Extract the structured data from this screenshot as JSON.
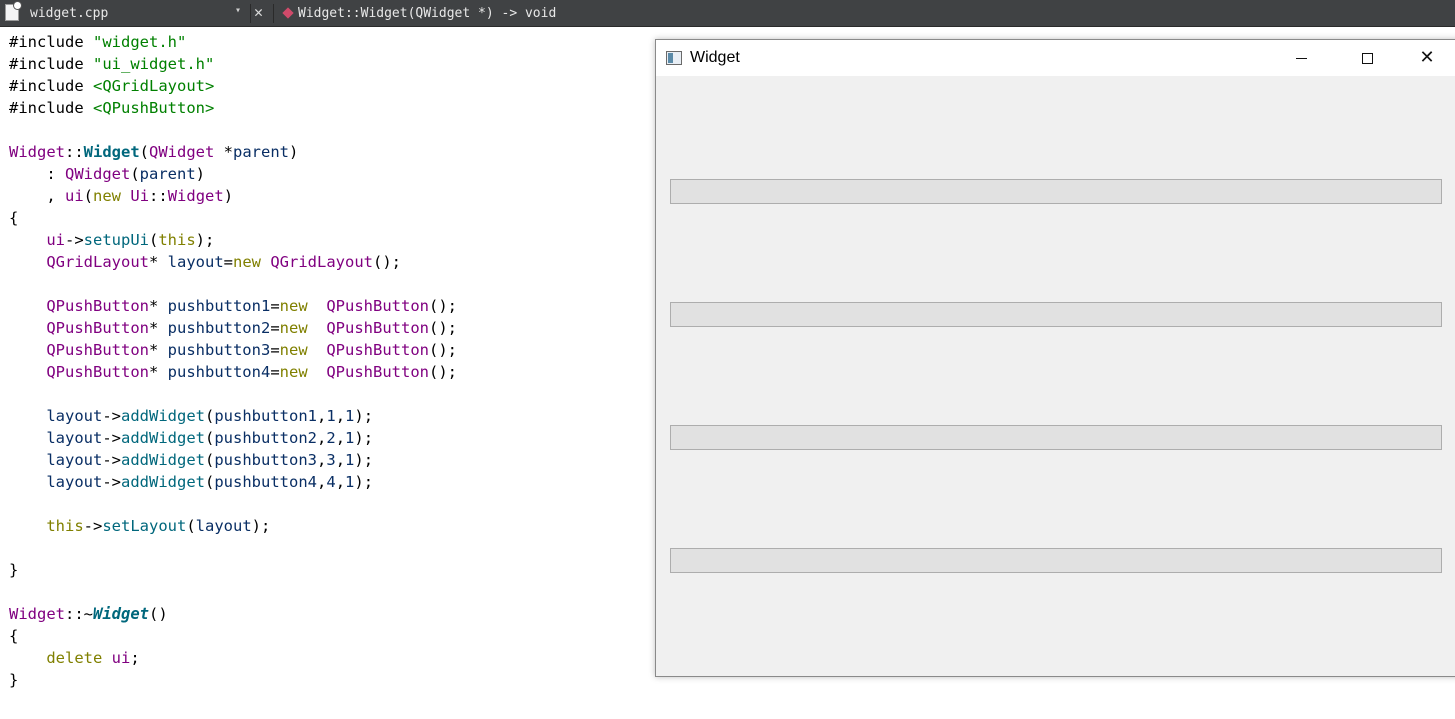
{
  "toolbar": {
    "file_name": "widget.cpp",
    "dropdown_glyph": "▾",
    "close_glyph": "✕",
    "symbol": "Widget::Widget(QWidget *) -> void"
  },
  "window": {
    "title": "Widget",
    "close_glyph": "✕",
    "buttons": [
      {
        "label": ""
      },
      {
        "label": ""
      },
      {
        "label": ""
      },
      {
        "label": ""
      }
    ]
  },
  "code": {
    "lines": [
      [
        {
          "t": "#include ",
          "c": ""
        },
        {
          "t": "\"widget.h\"",
          "c": "str"
        }
      ],
      [
        {
          "t": "#include ",
          "c": ""
        },
        {
          "t": "\"ui_widget.h\"",
          "c": "str"
        }
      ],
      [
        {
          "t": "#include ",
          "c": ""
        },
        {
          "t": "<QGridLayout>",
          "c": "str"
        }
      ],
      [
        {
          "t": "#include ",
          "c": ""
        },
        {
          "t": "<QPushButton>",
          "c": "str"
        }
      ],
      [],
      [
        {
          "t": "Widget",
          "c": "ty"
        },
        {
          "t": "::",
          "c": ""
        },
        {
          "t": "Widget",
          "c": "fnb"
        },
        {
          "t": "(",
          "c": ""
        },
        {
          "t": "QWidget",
          "c": "ty"
        },
        {
          "t": " *",
          "c": ""
        },
        {
          "t": "parent",
          "c": "var"
        },
        {
          "t": ")",
          "c": ""
        }
      ],
      [
        {
          "t": "    : ",
          "c": ""
        },
        {
          "t": "QWidget",
          "c": "ty"
        },
        {
          "t": "(",
          "c": ""
        },
        {
          "t": "parent",
          "c": "var"
        },
        {
          "t": ")",
          "c": ""
        }
      ],
      [
        {
          "t": "    , ",
          "c": ""
        },
        {
          "t": "ui",
          "c": "ty"
        },
        {
          "t": "(",
          "c": ""
        },
        {
          "t": "new",
          "c": "kw"
        },
        {
          "t": " ",
          "c": ""
        },
        {
          "t": "Ui",
          "c": "ty"
        },
        {
          "t": "::",
          "c": ""
        },
        {
          "t": "Widget",
          "c": "ty"
        },
        {
          "t": ")",
          "c": ""
        }
      ],
      [
        {
          "t": "{",
          "c": ""
        }
      ],
      [
        {
          "t": "    ",
          "c": ""
        },
        {
          "t": "ui",
          "c": "ty"
        },
        {
          "t": "->",
          "c": ""
        },
        {
          "t": "setupUi",
          "c": "fn"
        },
        {
          "t": "(",
          "c": ""
        },
        {
          "t": "this",
          "c": "kw"
        },
        {
          "t": ");",
          "c": ""
        }
      ],
      [
        {
          "t": "    ",
          "c": ""
        },
        {
          "t": "QGridLayout",
          "c": "ty"
        },
        {
          "t": "* ",
          "c": ""
        },
        {
          "t": "layout",
          "c": "var"
        },
        {
          "t": "=",
          "c": ""
        },
        {
          "t": "new",
          "c": "kw"
        },
        {
          "t": " ",
          "c": ""
        },
        {
          "t": "QGridLayout",
          "c": "ty"
        },
        {
          "t": "();",
          "c": ""
        }
      ],
      [],
      [
        {
          "t": "    ",
          "c": ""
        },
        {
          "t": "QPushButton",
          "c": "ty"
        },
        {
          "t": "* ",
          "c": ""
        },
        {
          "t": "pushbutton1",
          "c": "var"
        },
        {
          "t": "=",
          "c": ""
        },
        {
          "t": "new",
          "c": "kw"
        },
        {
          "t": "  ",
          "c": ""
        },
        {
          "t": "QPushButton",
          "c": "ty"
        },
        {
          "t": "();",
          "c": ""
        }
      ],
      [
        {
          "t": "    ",
          "c": ""
        },
        {
          "t": "QPushButton",
          "c": "ty"
        },
        {
          "t": "* ",
          "c": ""
        },
        {
          "t": "pushbutton2",
          "c": "var"
        },
        {
          "t": "=",
          "c": ""
        },
        {
          "t": "new",
          "c": "kw"
        },
        {
          "t": "  ",
          "c": ""
        },
        {
          "t": "QPushButton",
          "c": "ty"
        },
        {
          "t": "();",
          "c": ""
        }
      ],
      [
        {
          "t": "    ",
          "c": ""
        },
        {
          "t": "QPushButton",
          "c": "ty"
        },
        {
          "t": "* ",
          "c": ""
        },
        {
          "t": "pushbutton3",
          "c": "var"
        },
        {
          "t": "=",
          "c": ""
        },
        {
          "t": "new",
          "c": "kw"
        },
        {
          "t": "  ",
          "c": ""
        },
        {
          "t": "QPushButton",
          "c": "ty"
        },
        {
          "t": "();",
          "c": ""
        }
      ],
      [
        {
          "t": "    ",
          "c": ""
        },
        {
          "t": "QPushButton",
          "c": "ty"
        },
        {
          "t": "* ",
          "c": ""
        },
        {
          "t": "pushbutton4",
          "c": "var"
        },
        {
          "t": "=",
          "c": ""
        },
        {
          "t": "new",
          "c": "kw"
        },
        {
          "t": "  ",
          "c": ""
        },
        {
          "t": "QPushButton",
          "c": "ty"
        },
        {
          "t": "();",
          "c": ""
        }
      ],
      [],
      [
        {
          "t": "    ",
          "c": ""
        },
        {
          "t": "layout",
          "c": "var"
        },
        {
          "t": "->",
          "c": ""
        },
        {
          "t": "addWidget",
          "c": "fn"
        },
        {
          "t": "(",
          "c": ""
        },
        {
          "t": "pushbutton1",
          "c": "var"
        },
        {
          "t": ",",
          "c": ""
        },
        {
          "t": "1",
          "c": "var"
        },
        {
          "t": ",",
          "c": ""
        },
        {
          "t": "1",
          "c": "var"
        },
        {
          "t": ");",
          "c": ""
        }
      ],
      [
        {
          "t": "    ",
          "c": ""
        },
        {
          "t": "layout",
          "c": "var"
        },
        {
          "t": "->",
          "c": ""
        },
        {
          "t": "addWidget",
          "c": "fn"
        },
        {
          "t": "(",
          "c": ""
        },
        {
          "t": "pushbutton2",
          "c": "var"
        },
        {
          "t": ",",
          "c": ""
        },
        {
          "t": "2",
          "c": "var"
        },
        {
          "t": ",",
          "c": ""
        },
        {
          "t": "1",
          "c": "var"
        },
        {
          "t": ");",
          "c": ""
        }
      ],
      [
        {
          "t": "    ",
          "c": ""
        },
        {
          "t": "layout",
          "c": "var"
        },
        {
          "t": "->",
          "c": ""
        },
        {
          "t": "addWidget",
          "c": "fn"
        },
        {
          "t": "(",
          "c": ""
        },
        {
          "t": "pushbutton3",
          "c": "var"
        },
        {
          "t": ",",
          "c": ""
        },
        {
          "t": "3",
          "c": "var"
        },
        {
          "t": ",",
          "c": ""
        },
        {
          "t": "1",
          "c": "var"
        },
        {
          "t": ");",
          "c": ""
        }
      ],
      [
        {
          "t": "    ",
          "c": ""
        },
        {
          "t": "layout",
          "c": "var"
        },
        {
          "t": "->",
          "c": ""
        },
        {
          "t": "addWidget",
          "c": "fn"
        },
        {
          "t": "(",
          "c": ""
        },
        {
          "t": "pushbutton4",
          "c": "var"
        },
        {
          "t": ",",
          "c": ""
        },
        {
          "t": "4",
          "c": "var"
        },
        {
          "t": ",",
          "c": ""
        },
        {
          "t": "1",
          "c": "var"
        },
        {
          "t": ");",
          "c": ""
        }
      ],
      [],
      [
        {
          "t": "    ",
          "c": ""
        },
        {
          "t": "this",
          "c": "kw"
        },
        {
          "t": "->",
          "c": ""
        },
        {
          "t": "setLayout",
          "c": "fn"
        },
        {
          "t": "(",
          "c": ""
        },
        {
          "t": "layout",
          "c": "var"
        },
        {
          "t": ");",
          "c": ""
        }
      ],
      [],
      [
        {
          "t": "}",
          "c": ""
        }
      ],
      [],
      [
        {
          "t": "Widget",
          "c": "ty"
        },
        {
          "t": "::~",
          "c": ""
        },
        {
          "t": "Widget",
          "c": "fnbi"
        },
        {
          "t": "()",
          "c": ""
        }
      ],
      [
        {
          "t": "{",
          "c": ""
        }
      ],
      [
        {
          "t": "    ",
          "c": ""
        },
        {
          "t": "delete",
          "c": "kw"
        },
        {
          "t": " ",
          "c": ""
        },
        {
          "t": "ui",
          "c": "ty"
        },
        {
          "t": ";",
          "c": ""
        }
      ],
      [
        {
          "t": "}",
          "c": ""
        }
      ]
    ]
  }
}
